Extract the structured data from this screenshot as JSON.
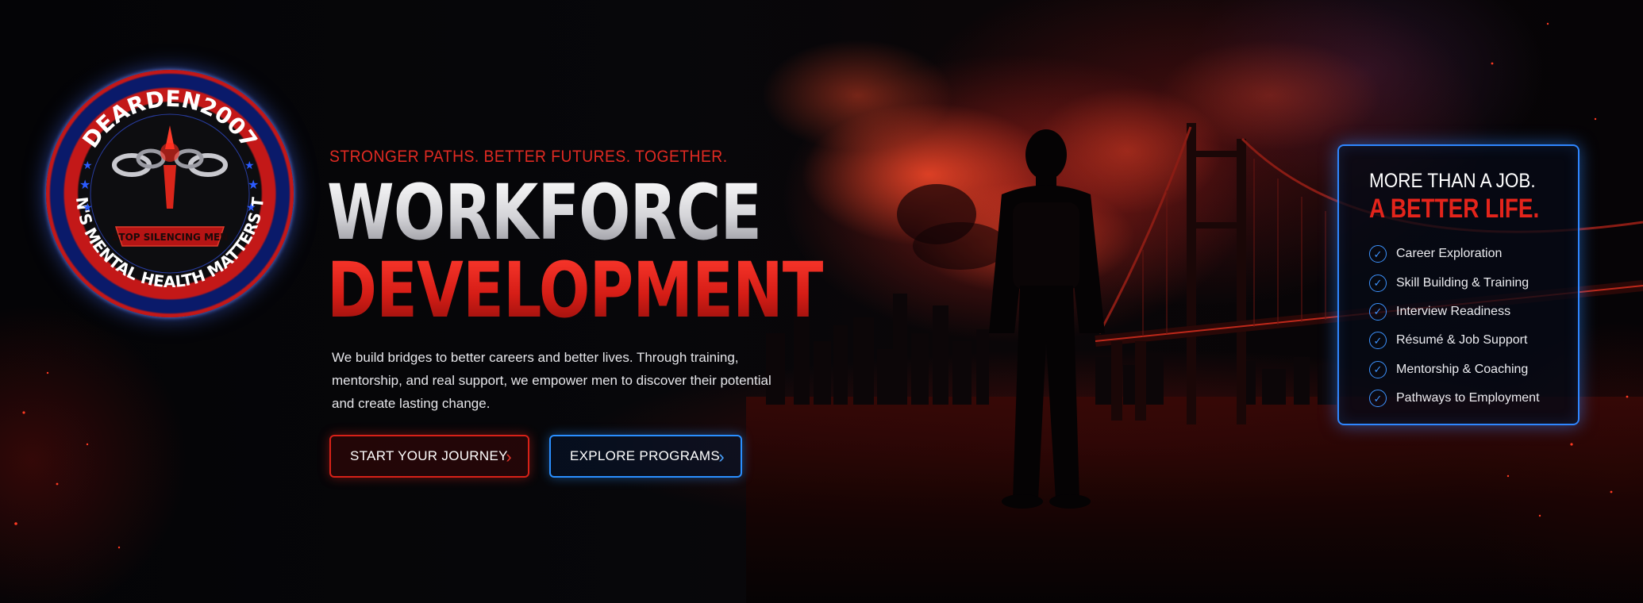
{
  "logo": {
    "name": "DEARDEN2007",
    "ribbon": "STOP SILENCING MEN",
    "motto": "MEN'S MENTAL HEALTH MATTERS TOO"
  },
  "hero": {
    "tagline": "STRONGER PATHS. BETTER FUTURES. TOGETHER.",
    "title_line1": "WORKFORCE",
    "title_line2": "DEVELOPMENT",
    "description": "We build bridges to better careers and better lives. Through training, mentorship, and real support, we empower men to discover their potential and create lasting change.",
    "buttons": [
      {
        "label": "START YOUR JOURNEY",
        "accent": "#d72118",
        "icon": "chevron-right-icon"
      },
      {
        "label": "EXPLORE PROGRAMS",
        "accent": "#2a8fff",
        "icon": "chevron-right-icon"
      }
    ]
  },
  "card": {
    "heading_line1": "MORE THAN A JOB.",
    "heading_line2": "A BETTER LIFE.",
    "items": [
      {
        "label": "Career Exploration",
        "icon": "check-circle-icon"
      },
      {
        "label": "Skill Building & Training",
        "icon": "check-circle-icon"
      },
      {
        "label": "Interview Readiness",
        "icon": "check-circle-icon"
      },
      {
        "label": "Résumé & Job Support",
        "icon": "check-circle-icon"
      },
      {
        "label": "Mentorship & Coaching",
        "icon": "check-circle-icon"
      },
      {
        "label": "Pathways to Employment",
        "icon": "check-circle-icon"
      }
    ]
  },
  "colors": {
    "accent_red": "#e3241b",
    "accent_blue": "#2f86ff",
    "background": "#050507"
  }
}
